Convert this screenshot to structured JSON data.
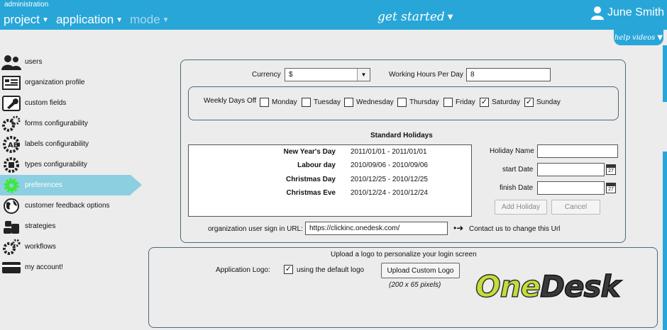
{
  "topbar": {
    "admin_label": "administration",
    "nav": [
      {
        "label": "project",
        "dim": false
      },
      {
        "label": "application",
        "dim": false
      },
      {
        "label": "mode",
        "dim": true
      }
    ],
    "get_started": "get started",
    "user_name": "June Smith",
    "help_videos": "help videos",
    "bg_color": "#29a6d8"
  },
  "sidebar": {
    "items": [
      {
        "label": "users",
        "icon": "users-icon"
      },
      {
        "label": "organization profile",
        "icon": "calendar-icon"
      },
      {
        "label": "custom fields",
        "icon": "wrench-icon"
      },
      {
        "label": "forms configurability",
        "icon": "gears-icon"
      },
      {
        "label": "labels configurability",
        "icon": "abc-gear-icon"
      },
      {
        "label": "types configurability",
        "icon": "puzzle-gear-icon"
      },
      {
        "label": "preferences",
        "icon": "gear-icon",
        "active": true
      },
      {
        "label": "customer feedback options",
        "icon": "globe-icon"
      },
      {
        "label": "strategies",
        "icon": "coins-icon"
      },
      {
        "label": "workflows",
        "icon": "cogs-icon"
      },
      {
        "label": "my account!",
        "icon": "card-icon"
      }
    ],
    "active_color": "#8ccfe0"
  },
  "preferences": {
    "currency_label": "Currency",
    "currency_value": "$",
    "hours_label": "Working Hours Per Day",
    "hours_value": "8",
    "weekly_label": "Weekly Days Off",
    "days": [
      {
        "label": "Monday",
        "checked": false
      },
      {
        "label": "Tuesday",
        "checked": false
      },
      {
        "label": "Wednesday",
        "checked": false
      },
      {
        "label": "Thursday",
        "checked": false
      },
      {
        "label": "Friday",
        "checked": false
      },
      {
        "label": "Saturday",
        "checked": true
      },
      {
        "label": "Sunday",
        "checked": true
      }
    ],
    "holidays_title": "Standard Holidays",
    "holidays": [
      {
        "name": "New Year's Day",
        "dates": "2011/01/01 - 2011/01/01"
      },
      {
        "name": "Labour day",
        "dates": "2010/09/06 - 2010/09/06"
      },
      {
        "name": "Christmas Day",
        "dates": "2010/12/25 - 2010/12/25"
      },
      {
        "name": "Christmas Eve",
        "dates": "2010/12/24 - 2010/12/24"
      }
    ],
    "holiday_name_label": "Holiday Name",
    "start_date_label": "start Date",
    "finish_date_label": "finish Date",
    "calendar_day": "27",
    "add_holiday": "Add Holiday",
    "cancel": "Cancel",
    "url_label": "organization user sign in URL:",
    "url_value": "https://clickinc.onedesk.com/",
    "url_contact": "Contact us to change this Url"
  },
  "logo_panel": {
    "title": "Upload a logo to personalize your login screen",
    "app_logo_label": "Application Logo:",
    "default_logo_label": "using the default logo",
    "default_checked": true,
    "upload_button": "Upload Custom Logo",
    "size_hint": "(200 x 65 pixels)",
    "logo_text_one": "One",
    "logo_text_desk": "Desk",
    "logo_colors": {
      "one": "#c6dd3a",
      "desk": "#3a3a3a"
    }
  }
}
